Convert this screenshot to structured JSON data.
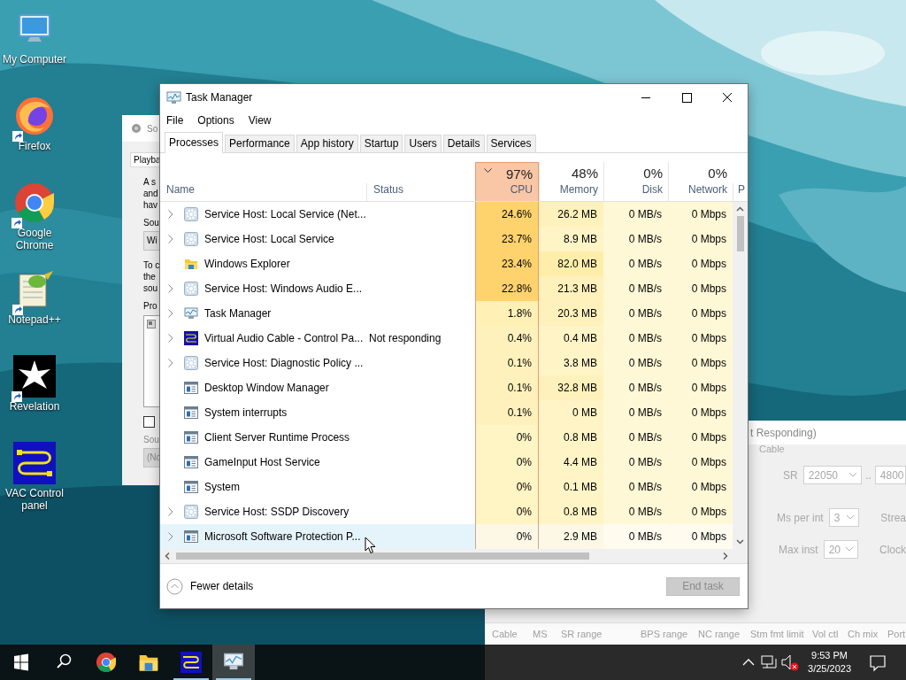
{
  "desktop_icons": [
    {
      "label": "My Computer",
      "kind": "computer",
      "shortcut": false
    },
    {
      "label": "Firefox",
      "kind": "firefox",
      "shortcut": true
    },
    {
      "label": "Google Chrome",
      "kind": "chrome",
      "shortcut": true
    },
    {
      "label": "Notepad++",
      "kind": "notepad",
      "shortcut": true
    },
    {
      "label": "Revelation",
      "kind": "revelation",
      "shortcut": true
    },
    {
      "label": "VAC Control panel",
      "kind": "vac",
      "shortcut": false
    }
  ],
  "sound_window": {
    "title": "So",
    "tab": "Playba",
    "lines_1": [
      "A s",
      "and",
      "hav"
    ],
    "label_1": "Sou",
    "dropdown_1": "Wi",
    "lines_2": [
      "To c",
      "the",
      "sou"
    ],
    "label_2": "Pro",
    "checkbox": {
      "checked": false
    },
    "label_3": "Sou",
    "dropdown_2": "(No"
  },
  "vac_window": {
    "title": "t Responding)",
    "group": "Cable",
    "sr_label": "SR",
    "sr_from": "22050",
    "sr_separator": "..",
    "sr_to": "4800",
    "ms_label": "Ms per int",
    "ms_value": "3",
    "stream_label": "Strea",
    "max_label": "Max inst",
    "max_value": "20",
    "clock_label": "Clock",
    "columns": [
      "Cable",
      "MS",
      "SR range",
      "BPS range",
      "NC range",
      "Stm fmt limit",
      "Vol ctl",
      "Ch mix",
      "Port"
    ]
  },
  "task_manager": {
    "title": "Task Manager",
    "menu": [
      "File",
      "Options",
      "View"
    ],
    "tabs": [
      {
        "label": "Processes",
        "selected": true
      },
      {
        "label": "Performance",
        "selected": false
      },
      {
        "label": "App history",
        "selected": false
      },
      {
        "label": "Startup",
        "selected": false
      },
      {
        "label": "Users",
        "selected": false
      },
      {
        "label": "Details",
        "selected": false
      },
      {
        "label": "Services",
        "selected": false
      }
    ],
    "name_header": "Name",
    "status_header": "Status",
    "metric_columns": [
      {
        "percent": "97%",
        "label": "CPU",
        "sorted": true
      },
      {
        "percent": "48%",
        "label": "Memory",
        "sorted": false
      },
      {
        "percent": "0%",
        "label": "Disk",
        "sorted": false
      },
      {
        "percent": "0%",
        "label": "Network",
        "sorted": false
      }
    ],
    "column_7": "P",
    "rows": [
      {
        "name": "Service Host: Local Service (Net...",
        "cpu": "24.6%",
        "memory": "26.2 MB",
        "disk": "0 MB/s",
        "network": "0 Mbps",
        "kind": "service-host",
        "expandable": true,
        "hovered": false
      },
      {
        "name": "Service Host: Local Service",
        "cpu": "23.7%",
        "memory": "8.9 MB",
        "disk": "0 MB/s",
        "network": "0 Mbps",
        "kind": "service-host",
        "expandable": true,
        "hovered": false
      },
      {
        "name": "Windows Explorer",
        "cpu": "23.4%",
        "memory": "82.0 MB",
        "disk": "0 MB/s",
        "network": "0 Mbps",
        "kind": "explorer",
        "expandable": false,
        "hovered": false
      },
      {
        "name": "Service Host: Windows Audio E...",
        "cpu": "22.8%",
        "memory": "21.3 MB",
        "disk": "0 MB/s",
        "network": "0 Mbps",
        "kind": "service-host",
        "expandable": true,
        "hovered": false
      },
      {
        "name": "Task Manager",
        "cpu": "1.8%",
        "memory": "20.3 MB",
        "disk": "0 MB/s",
        "network": "0 Mbps",
        "kind": "task-manager",
        "expandable": true,
        "hovered": false
      },
      {
        "name": "Virtual Audio Cable - Control Pa...",
        "status": "Not responding",
        "cpu": "0.4%",
        "memory": "0.4 MB",
        "disk": "0 MB/s",
        "network": "0 Mbps",
        "kind": "vac",
        "expandable": true,
        "hovered": false
      },
      {
        "name": "Service Host: Diagnostic Policy ...",
        "cpu": "0.1%",
        "memory": "3.8 MB",
        "disk": "0 MB/s",
        "network": "0 Mbps",
        "kind": "service-host",
        "expandable": true,
        "hovered": false
      },
      {
        "name": "Desktop Window Manager",
        "cpu": "0.1%",
        "memory": "32.8 MB",
        "disk": "0 MB/s",
        "network": "0 Mbps",
        "kind": "process",
        "expandable": false,
        "hovered": false
      },
      {
        "name": "System interrupts",
        "cpu": "0.1%",
        "memory": "0 MB",
        "disk": "0 MB/s",
        "network": "0 Mbps",
        "kind": "process",
        "expandable": false,
        "hovered": false
      },
      {
        "name": "Client Server Runtime Process",
        "cpu": "0%",
        "memory": "0.8 MB",
        "disk": "0 MB/s",
        "network": "0 Mbps",
        "kind": "process",
        "expandable": false,
        "hovered": false
      },
      {
        "name": "GameInput Host Service",
        "cpu": "0%",
        "memory": "4.4 MB",
        "disk": "0 MB/s",
        "network": "0 Mbps",
        "kind": "process",
        "expandable": false,
        "hovered": false
      },
      {
        "name": "System",
        "cpu": "0%",
        "memory": "0.1 MB",
        "disk": "0 MB/s",
        "network": "0 Mbps",
        "kind": "process",
        "expandable": false,
        "hovered": false
      },
      {
        "name": "Service Host: SSDP Discovery",
        "cpu": "0%",
        "memory": "0.8 MB",
        "disk": "0 MB/s",
        "network": "0 Mbps",
        "kind": "service-host",
        "expandable": true,
        "hovered": false
      },
      {
        "name": "Microsoft Software Protection P...",
        "cpu": "0%",
        "memory": "2.9 MB",
        "disk": "0 MB/s",
        "network": "0 Mbps",
        "kind": "process",
        "expandable": true,
        "hovered": true
      }
    ],
    "fewer_details": "Fewer details",
    "end_task": {
      "label": "End task",
      "disabled": true
    }
  },
  "taskbar": {
    "apps": [
      {
        "kind": "chrome",
        "running": false,
        "active": false
      },
      {
        "kind": "explorer",
        "running": false,
        "active": false
      },
      {
        "kind": "vac",
        "running": true,
        "active": false
      },
      {
        "kind": "task-manager",
        "running": true,
        "active": true
      }
    ],
    "volume_muted": true,
    "time": "9:53 PM",
    "date": "3/25/2023"
  }
}
